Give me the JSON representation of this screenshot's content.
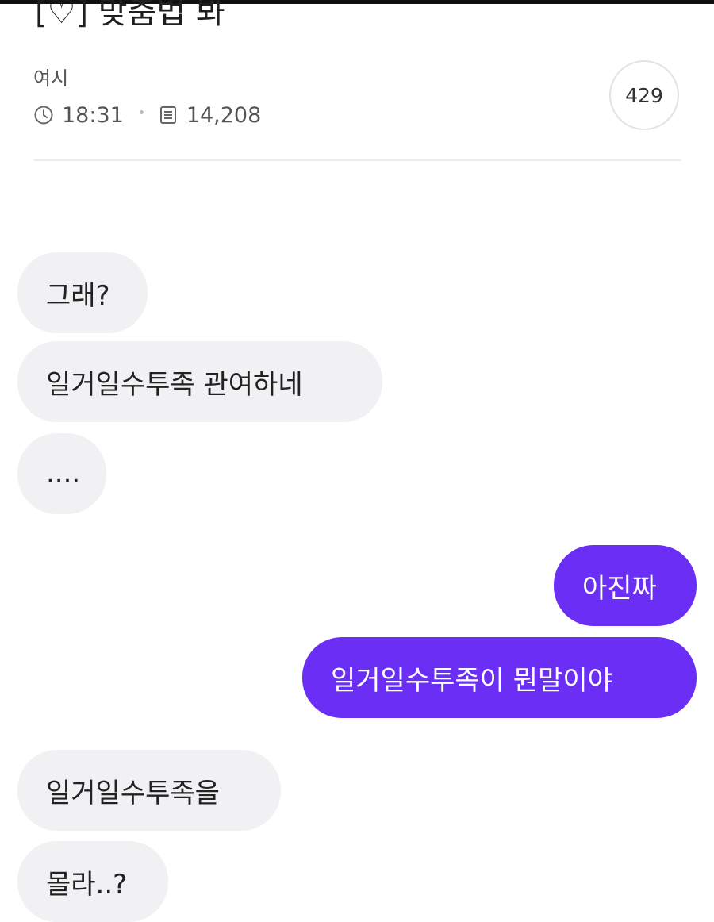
{
  "post": {
    "title": "[♡] 맞춤법 봐",
    "author": "여시",
    "time": "18:31",
    "views": "14,208",
    "comment_count": "429"
  },
  "icons": {
    "time": "clock-icon",
    "views": "document-icon"
  },
  "colors": {
    "outgoing_bubble": "#6b2ef5",
    "incoming_bubble": "#f1f1f4"
  },
  "messages": [
    {
      "direction": "incoming",
      "text": "그래?"
    },
    {
      "direction": "incoming",
      "text": "일거일수투족 관여하네"
    },
    {
      "direction": "incoming",
      "text": "...."
    },
    {
      "direction": "outgoing",
      "text": "아진짜"
    },
    {
      "direction": "outgoing",
      "text": "일거일수투족이 뭔말이야"
    },
    {
      "direction": "incoming",
      "text": "일거일수투족을"
    },
    {
      "direction": "incoming",
      "text": "몰라..?"
    }
  ]
}
